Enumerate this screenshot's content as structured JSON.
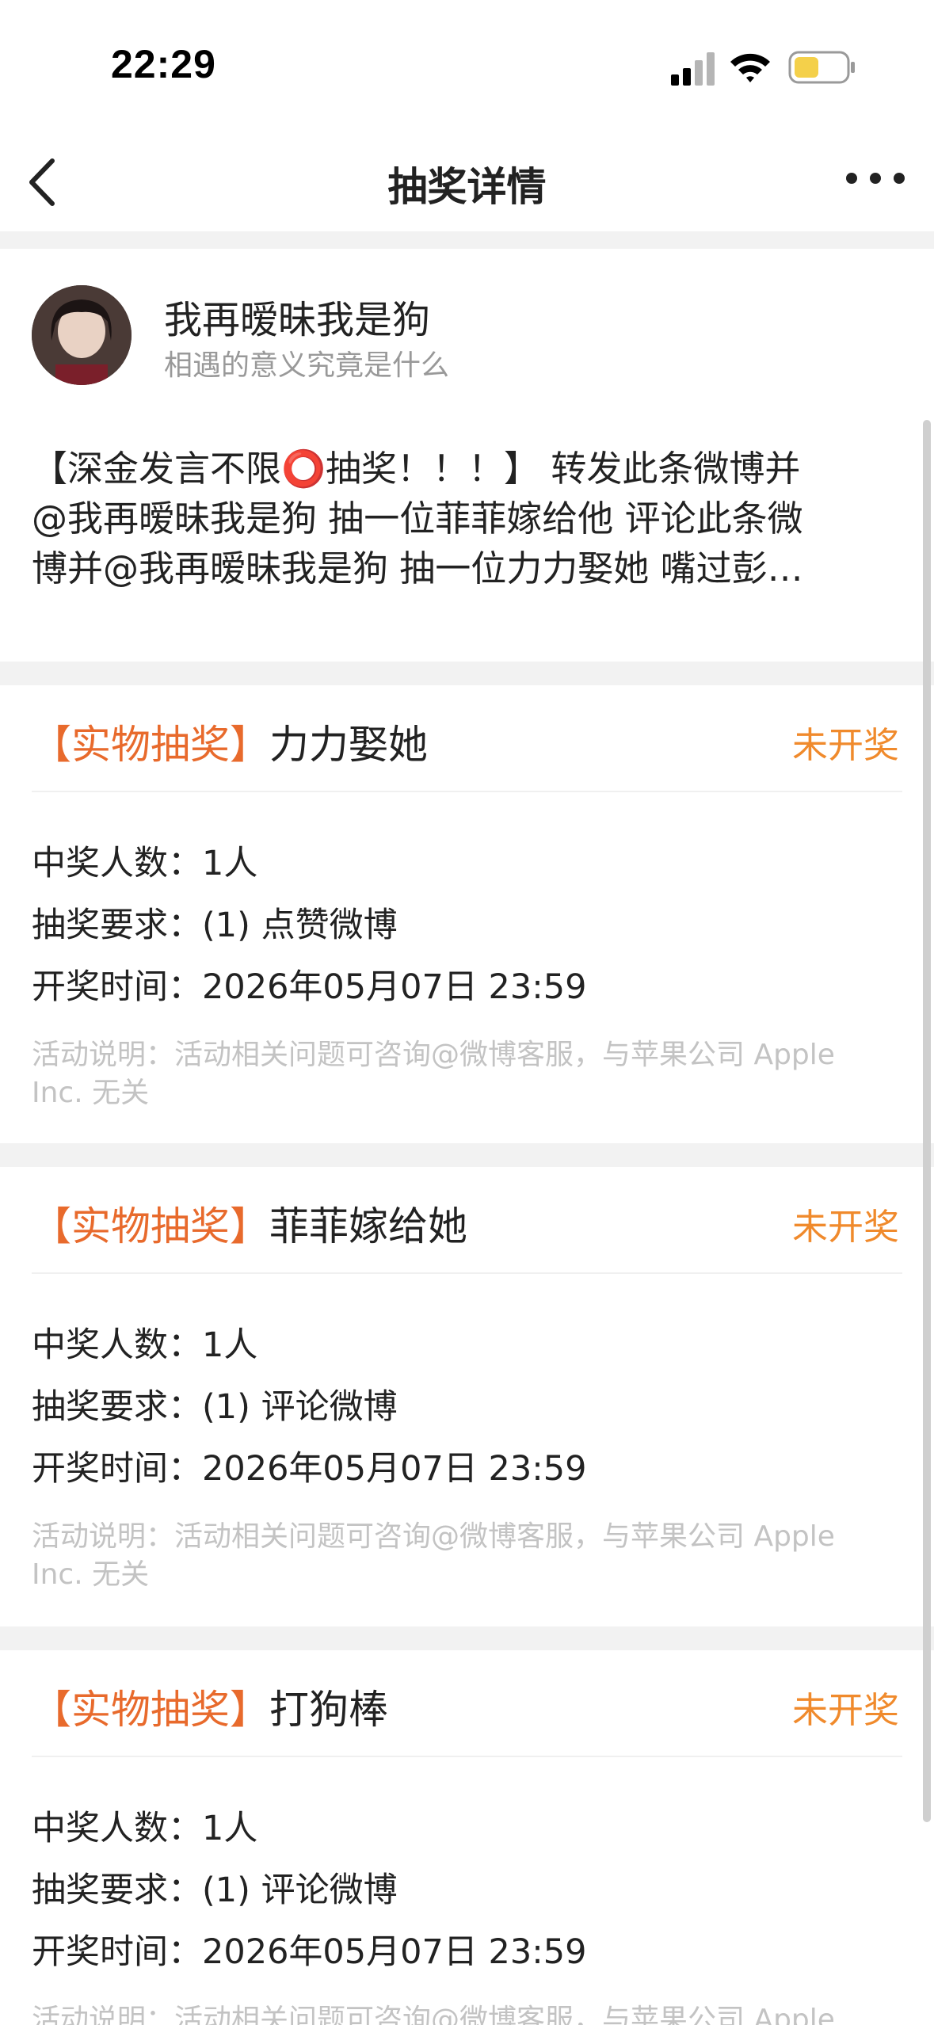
{
  "status_bar": {
    "time": "22:29"
  },
  "nav": {
    "title": "抽奖详情"
  },
  "author": {
    "name": "我再暧昧我是狗",
    "subtitle": "相遇的意义究竟是什么"
  },
  "post": {
    "text": "【深金发言不限⭕抽奖！！！】 转发此条微博并\n@我再暧昧我是狗 抽一位菲菲嫁给他 评论此条微\n博并@我再暧昧我是狗 抽一位力力娶她 嘴过彭…"
  },
  "cards": [
    {
      "tag": "【实物抽奖】",
      "title": "力力娶她",
      "status": "未开奖",
      "winners": "中奖人数：1人",
      "requirement": "抽奖要求：(1) 点赞微博",
      "draw_time": "开奖时间：2026年05月07日 23:59",
      "note": "活动说明：活动相关问题可咨询@微博客服，与苹果公司 Apple Inc. 无关"
    },
    {
      "tag": "【实物抽奖】",
      "title": "菲菲嫁给她",
      "status": "未开奖",
      "winners": "中奖人数：1人",
      "requirement": "抽奖要求：(1) 评论微博",
      "draw_time": "开奖时间：2026年05月07日 23:59",
      "note": "活动说明：活动相关问题可咨询@微博客服，与苹果公司 Apple Inc. 无关"
    },
    {
      "tag": "【实物抽奖】",
      "title": "打狗棒",
      "status": "未开奖",
      "winners": "中奖人数：1人",
      "requirement": "抽奖要求：(1) 评论微博",
      "draw_time": "开奖时间：2026年05月07日 23:59",
      "note": "活动说明：活动相关问题可咨询@微博客服，与苹果公司 Apple"
    }
  ],
  "colors": {
    "tag": "#e86a2c",
    "status": "#f08a2c",
    "note": "#c3c3c3",
    "divider_bg": "#f2f2f2"
  },
  "icons": [
    "signal-icon",
    "wifi-icon",
    "battery-icon",
    "back-icon",
    "more-icon"
  ]
}
